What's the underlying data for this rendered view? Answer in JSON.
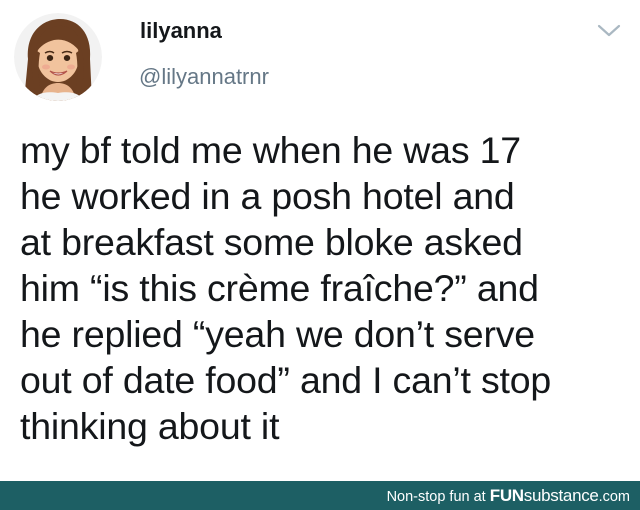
{
  "tweet": {
    "display_name": "lilyanna",
    "handle": "@lilyannatrnr",
    "text": "my bf told me when he was 17\nhe worked in a posh hotel and\nat breakfast some bloke asked\nhim “is this crème fraîche?” and\nhe replied “yeah we don’t serve\nout of date food” and I can’t stop\nthinking about it",
    "menu_icon": "chevron-down-icon",
    "avatar_icon": "memoji-avatar"
  },
  "footer": {
    "prefix": "Non-stop fun at ",
    "brand_bold": "FUN",
    "brand_light": "substance",
    "brand_suffix": ".com"
  },
  "colors": {
    "name": "#14171a",
    "handle": "#657786",
    "footer_bg": "#1d5f64",
    "footer_text": "#ffffff",
    "chevron": "#aab8c2"
  }
}
